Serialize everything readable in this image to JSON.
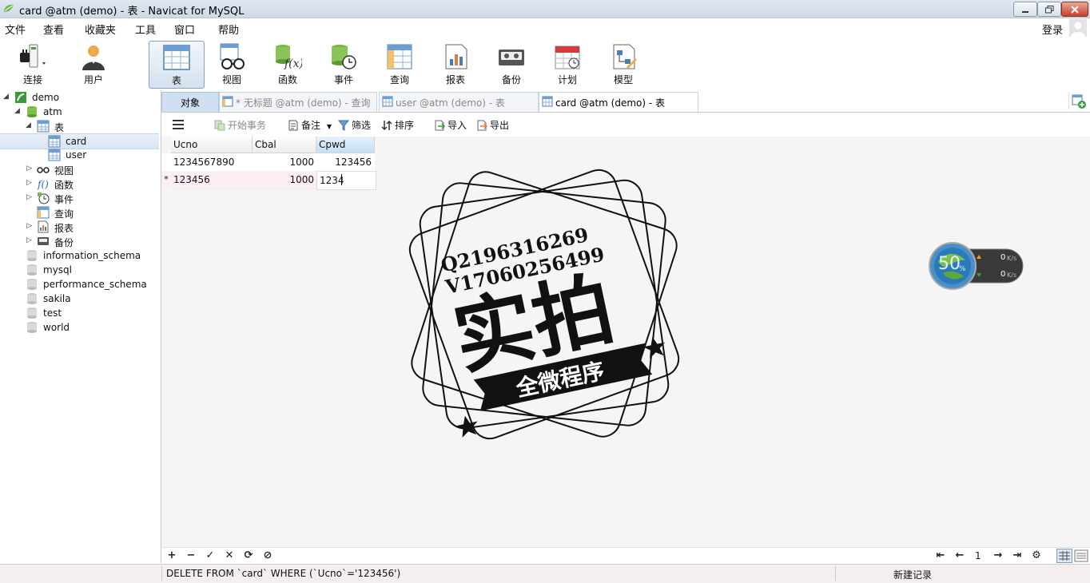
{
  "window": {
    "title": "card @atm (demo) - 表 - Navicat for MySQL"
  },
  "menu": {
    "items": [
      "文件",
      "查看",
      "收藏夹",
      "工具",
      "窗口",
      "帮助"
    ],
    "login": "登录"
  },
  "toolbar": {
    "items": [
      {
        "label": "连接",
        "icon": "plug-icon"
      },
      {
        "label": "用户",
        "icon": "user-icon"
      },
      {
        "label": "表",
        "icon": "table-icon",
        "active": true
      },
      {
        "label": "视图",
        "icon": "view-glasses-icon"
      },
      {
        "label": "函数",
        "icon": "function-icon"
      },
      {
        "label": "事件",
        "icon": "event-clock-icon"
      },
      {
        "label": "查询",
        "icon": "query-icon"
      },
      {
        "label": "报表",
        "icon": "report-icon"
      },
      {
        "label": "备份",
        "icon": "backup-icon"
      },
      {
        "label": "计划",
        "icon": "schedule-calendar-icon"
      },
      {
        "label": "模型",
        "icon": "model-icon"
      }
    ]
  },
  "sidebar": {
    "connection": "demo",
    "database": "atm",
    "tables_group": "表",
    "tables": [
      "card",
      "user"
    ],
    "selected_table": "card",
    "groups": [
      "视图",
      "函数",
      "事件",
      "查询",
      "报表",
      "备份"
    ],
    "other_databases": [
      "information_schema",
      "mysql",
      "performance_schema",
      "sakila",
      "test",
      "world"
    ]
  },
  "tabs": [
    {
      "label": "对象",
      "kind": "object"
    },
    {
      "label": "* 无标题 @atm (demo) - 查询",
      "kind": "query"
    },
    {
      "label": "user @atm (demo) - 表",
      "kind": "table"
    },
    {
      "label": "card @atm (demo) - 表",
      "kind": "table",
      "current": true
    }
  ],
  "grid_toolbar": {
    "begin_transaction": "开始事务",
    "memo": "备注",
    "filter": "筛选",
    "sort": "排序",
    "import": "导入",
    "export": "导出"
  },
  "table": {
    "columns": [
      "Ucno",
      "Cbal",
      "Cpwd"
    ],
    "selected_column": "Cpwd",
    "rows": [
      {
        "marker": "",
        "Ucno": "1234567890",
        "Cbal": "1000",
        "Cpwd": "123456"
      },
      {
        "marker": "*",
        "Ucno": "123456",
        "Cbal": "1000",
        "Cpwd": "1234"
      }
    ]
  },
  "watermark": {
    "line1": "Q2196316269",
    "line2": "V17060256499",
    "main": "实拍",
    "ribbon": "全微程序"
  },
  "speed_widget": {
    "percent": "50",
    "percent_sign": "%",
    "up": "0",
    "down": "0",
    "unit": "K/s"
  },
  "pager": {
    "page": "1"
  },
  "status": {
    "sql": "DELETE FROM `card` WHERE (`Ucno`='123456')",
    "right": "新建记录"
  }
}
